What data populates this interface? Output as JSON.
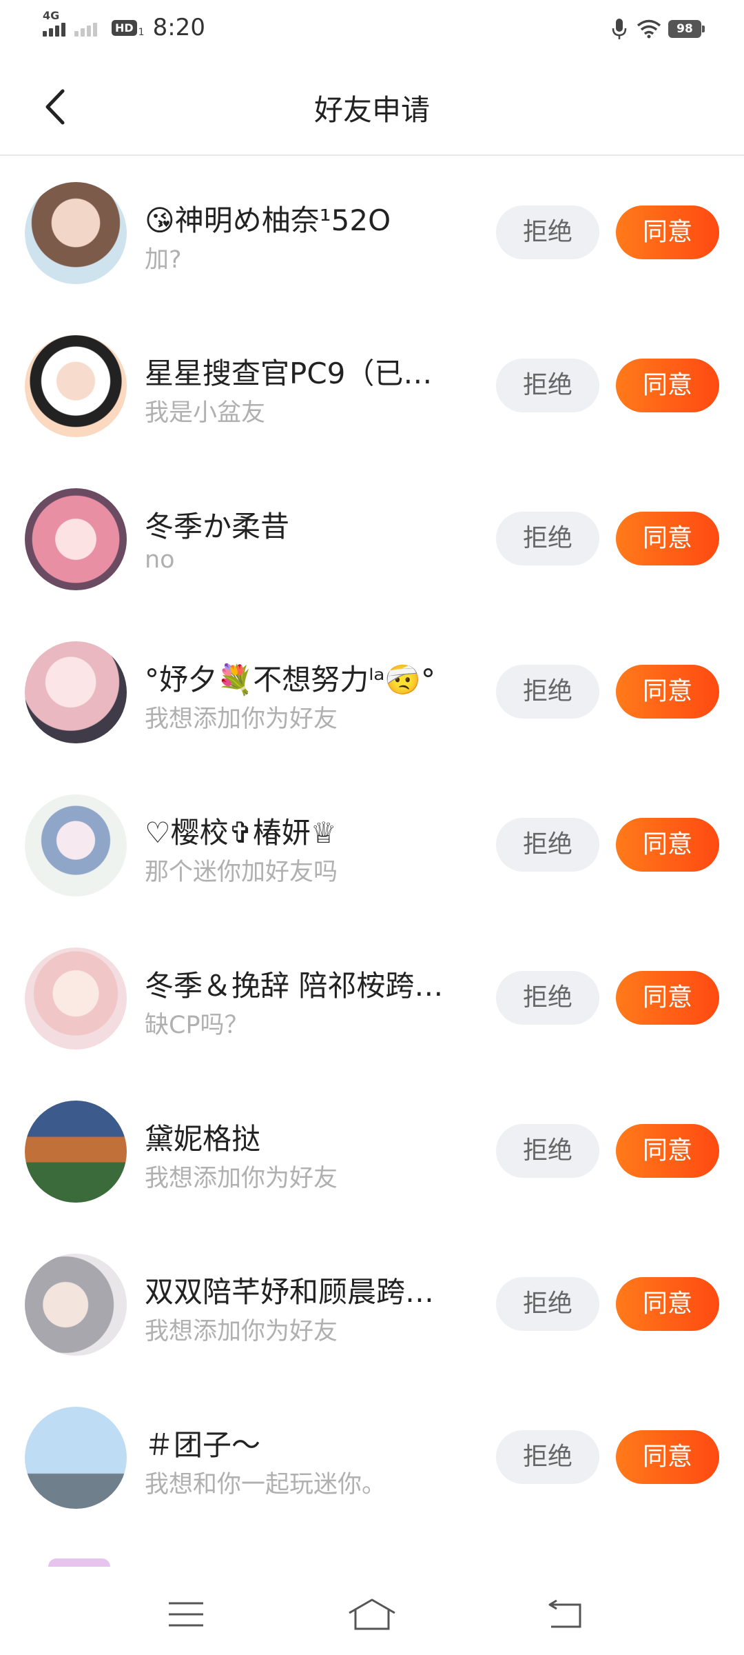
{
  "status_bar": {
    "network": "4G",
    "hd": "HD",
    "hd_sub": "1",
    "time": "8:20",
    "battery": "98"
  },
  "header": {
    "title": "好友申请"
  },
  "buttons": {
    "reject": "拒绝",
    "accept": "同意"
  },
  "requests": [
    {
      "name": "😘神明め柚奈¹52O",
      "message": "加?"
    },
    {
      "name": "星星搜查官PC9（已…",
      "message": "我是小盆友"
    },
    {
      "name": "冬季か柔昔",
      "message": "no"
    },
    {
      "name": "°妤夕💐不想努力ˡᵃ🤕°",
      "message": "我想添加你为好友"
    },
    {
      "name": "♡樱校✞椿妍♕",
      "message": "那个迷你加好友吗"
    },
    {
      "name": "冬季＆挽辞  陪祁桉跨…",
      "message": "缺CP吗？"
    },
    {
      "name": "黛妮格挞",
      "message": "我想添加你为好友"
    },
    {
      "name": "双双陪芊妤和顾晨跨…",
      "message": "我想添加你为好友"
    },
    {
      "name": "＃团子～",
      "message": "我想和你一起玩迷你。"
    }
  ],
  "nav": {
    "menu_icon": "menu-icon",
    "home_icon": "home-icon",
    "back_icon": "back-icon"
  }
}
